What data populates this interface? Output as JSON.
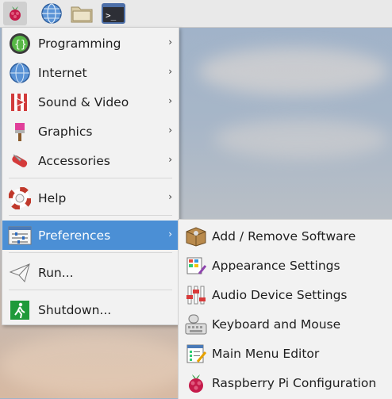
{
  "taskbar": {
    "buttons": [
      {
        "name": "raspberry-menu-icon"
      },
      {
        "name": "web-browser-icon"
      },
      {
        "name": "file-manager-icon"
      },
      {
        "name": "terminal-icon"
      }
    ]
  },
  "main_menu": {
    "items": [
      {
        "label": "Programming",
        "icon": "programming-icon",
        "has_submenu": true
      },
      {
        "label": "Internet",
        "icon": "internet-globe-icon",
        "has_submenu": true
      },
      {
        "label": "Sound & Video",
        "icon": "sound-video-icon",
        "has_submenu": true
      },
      {
        "label": "Graphics",
        "icon": "graphics-brush-icon",
        "has_submenu": true
      },
      {
        "label": "Accessories",
        "icon": "accessories-knife-icon",
        "has_submenu": true
      },
      {
        "label": "Help",
        "icon": "help-lifebuoy-icon",
        "has_submenu": true
      },
      {
        "label": "Preferences",
        "icon": "preferences-icon",
        "has_submenu": true,
        "selected": true
      },
      {
        "label": "Run...",
        "icon": "run-paper-plane-icon",
        "has_submenu": false
      },
      {
        "label": "Shutdown...",
        "icon": "shutdown-exit-icon",
        "has_submenu": false
      }
    ],
    "submenu_arrow": "›"
  },
  "preferences_submenu": {
    "items": [
      {
        "label": "Add / Remove Software",
        "icon": "package-icon"
      },
      {
        "label": "Appearance Settings",
        "icon": "appearance-icon"
      },
      {
        "label": "Audio Device Settings",
        "icon": "audio-sliders-icon"
      },
      {
        "label": "Keyboard and Mouse",
        "icon": "keyboard-mouse-icon"
      },
      {
        "label": "Main Menu Editor",
        "icon": "menu-editor-icon"
      },
      {
        "label": "Raspberry Pi Configuration",
        "icon": "raspberry-config-icon"
      }
    ]
  },
  "colors": {
    "selected_bg": "#4b8fd5",
    "menu_bg": "#f2f2f2"
  }
}
